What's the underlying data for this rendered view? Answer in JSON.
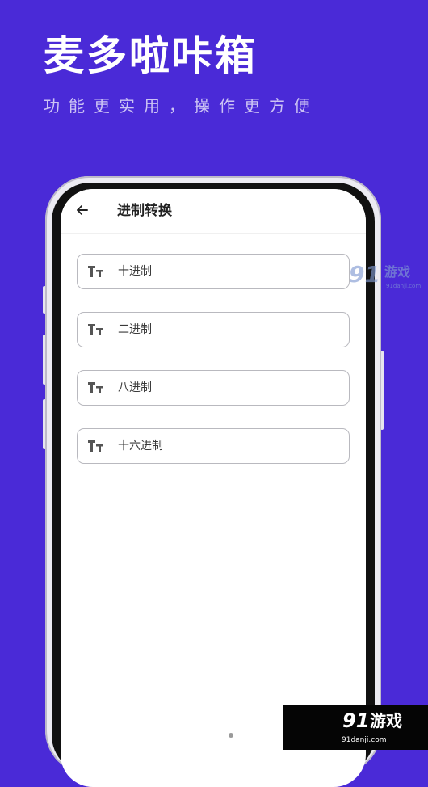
{
  "promo": {
    "title": "麦多啦咔箱",
    "subtitle": "功能更实用，操作更方便"
  },
  "app": {
    "header_title": "进制转换",
    "options": [
      {
        "label": "十进制",
        "icon": "text-size-icon"
      },
      {
        "label": "二进制",
        "icon": "text-size-icon"
      },
      {
        "label": "八进制",
        "icon": "text-size-icon"
      },
      {
        "label": "十六进制",
        "icon": "text-size-icon"
      }
    ]
  },
  "watermark": {
    "top_number": "91",
    "top_text": "游戏",
    "top_domain": "91danji.com",
    "bottom_number": "91",
    "bottom_text": "游戏",
    "bottom_domain": "91danji.com"
  },
  "colors": {
    "background": "#4a2ad7",
    "screen": "#ffffff",
    "text_dark": "#222222",
    "border": "#b9b9bf"
  }
}
